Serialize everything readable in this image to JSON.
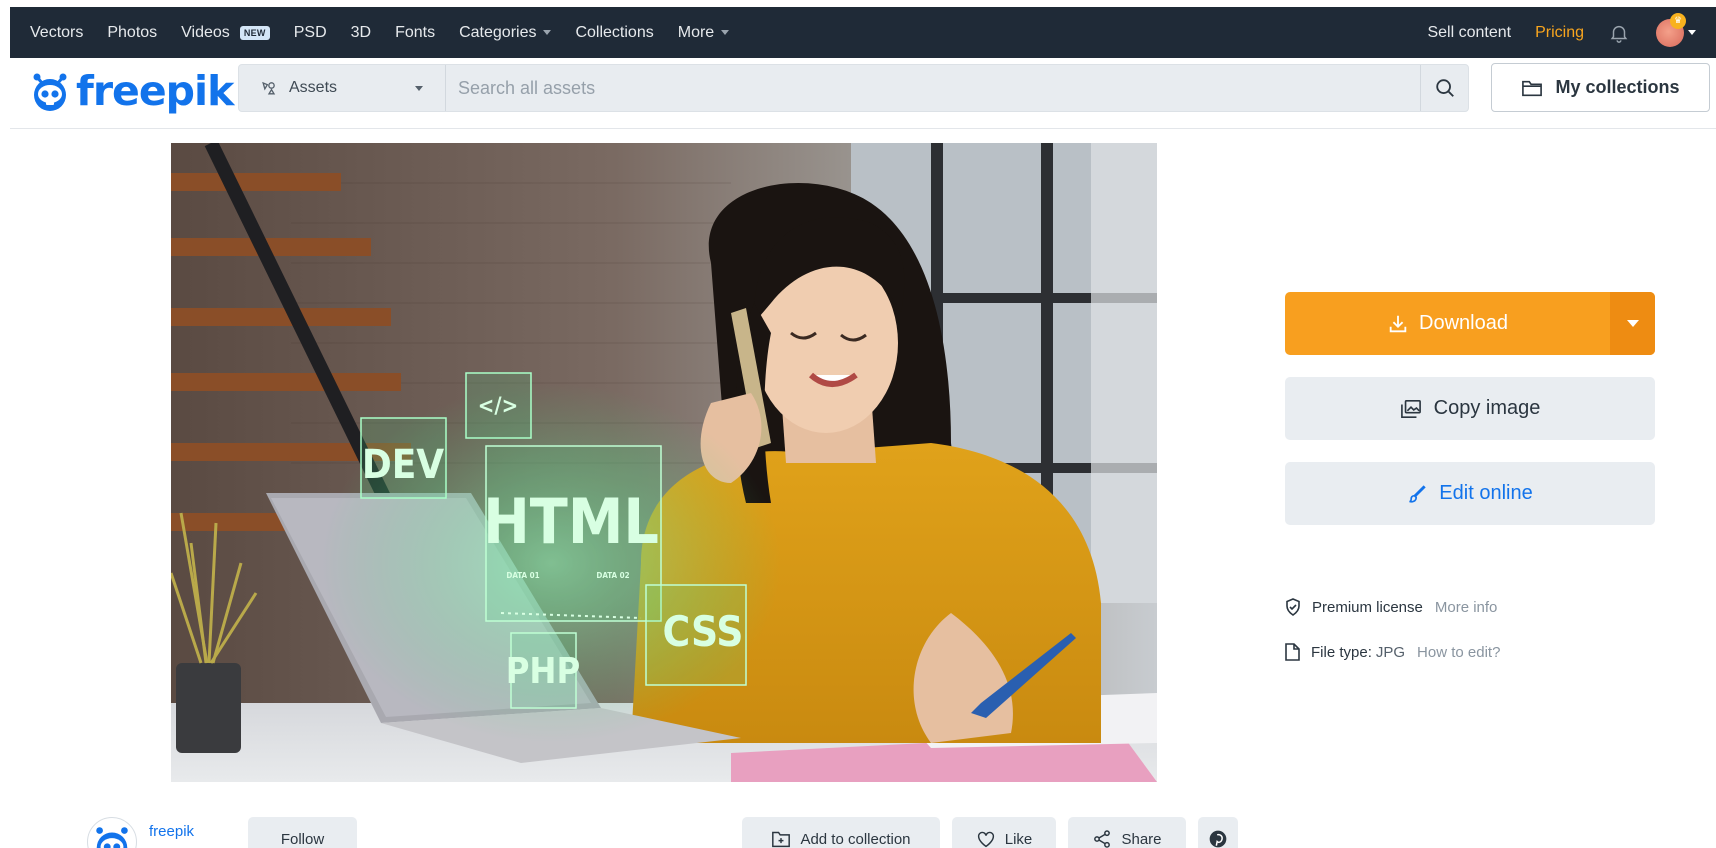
{
  "topnav": {
    "items": [
      "Vectors",
      "Photos",
      "Videos",
      "PSD",
      "3D",
      "Fonts",
      "Categories",
      "Collections",
      "More"
    ],
    "videos_badge": "NEW",
    "sell_content": "Sell content",
    "pricing": "Pricing"
  },
  "header": {
    "logo_text": "freepik",
    "search": {
      "type_label": "Assets",
      "placeholder": "Search all assets"
    },
    "my_collections": "My collections"
  },
  "photo": {
    "overlay_labels": [
      "</>",
      "DEV",
      "HTML",
      "DATA 01",
      "DATA 02",
      "CSS",
      "PHP"
    ]
  },
  "panel": {
    "download": "Download",
    "copy_image": "Copy image",
    "edit_online": "Edit online",
    "license_label": "Premium license",
    "license_link": "More info",
    "file_type_label": "File type:",
    "file_type_value": "JPG",
    "file_type_link": "How to edit?"
  },
  "footer": {
    "author_name": "freepik",
    "follow": "Follow",
    "add_to_collection": "Add to collection",
    "like": "Like",
    "share": "Share"
  },
  "colors": {
    "nav_bg": "#1f2a37",
    "brand_blue": "#1273eb",
    "download_orange": "#f89f1f",
    "pricing_orange": "#f8a51e"
  }
}
